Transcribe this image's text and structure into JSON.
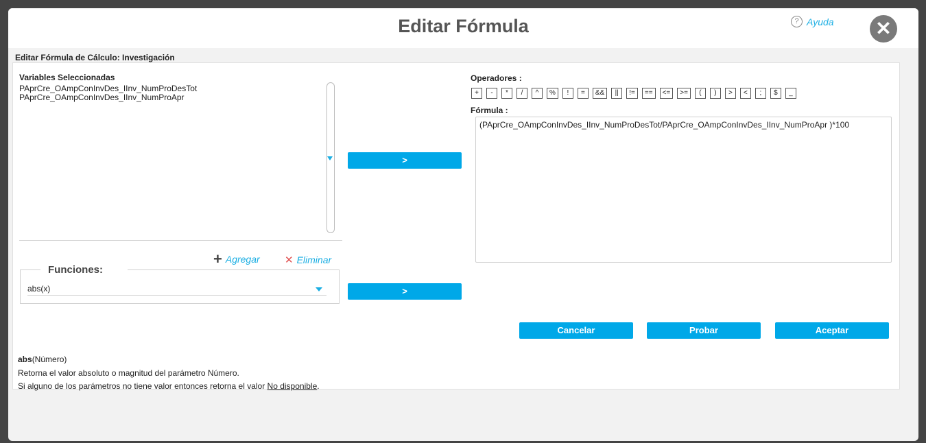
{
  "modal": {
    "title": "Editar Fórmula",
    "help_label": "Ayuda",
    "section_title": "Editar Fórmula de Cálculo: Investigación"
  },
  "variables": {
    "label": "Variables Seleccionadas",
    "items": [
      "PAprCre_OAmpConInvDes_IInv_NumProDesTot",
      "PAprCre_OAmpConInvDes_IInv_NumProApr"
    ],
    "add_label": "Agregar",
    "remove_label": "Eliminar",
    "insert_button": ">"
  },
  "functions": {
    "label": "Funciones:",
    "selected": "abs(x)",
    "insert_button": ">"
  },
  "operators": {
    "label": "Operadores :",
    "items": [
      "+",
      "-",
      "*",
      "/",
      "^",
      "%",
      "!",
      "=",
      "&&",
      "||",
      "!=",
      "==",
      "<=",
      ">=",
      "(",
      ")",
      ">",
      "<",
      ";",
      "$",
      "_"
    ]
  },
  "formula": {
    "label": "Fórmula :",
    "value": "(PAprCre_OAmpConInvDes_IInv_NumProDesTot/PAprCre_OAmpConInvDes_IInv_NumProApr )*100"
  },
  "actions": {
    "cancel": "Cancelar",
    "test": "Probar",
    "accept": "Aceptar"
  },
  "description": {
    "signature_name": "abs",
    "signature_args": "(Número)",
    "line1": "Retorna el valor absoluto o magnitud del parámetro Número.",
    "line2_prefix": "Si alguno de los parámetros no tiene valor entonces retorna el valor ",
    "line2_link": "No disponible",
    "line2_suffix": "."
  },
  "colors": {
    "accent": "#00a8e8",
    "link": "#1aaee3",
    "remove": "#e05050"
  }
}
